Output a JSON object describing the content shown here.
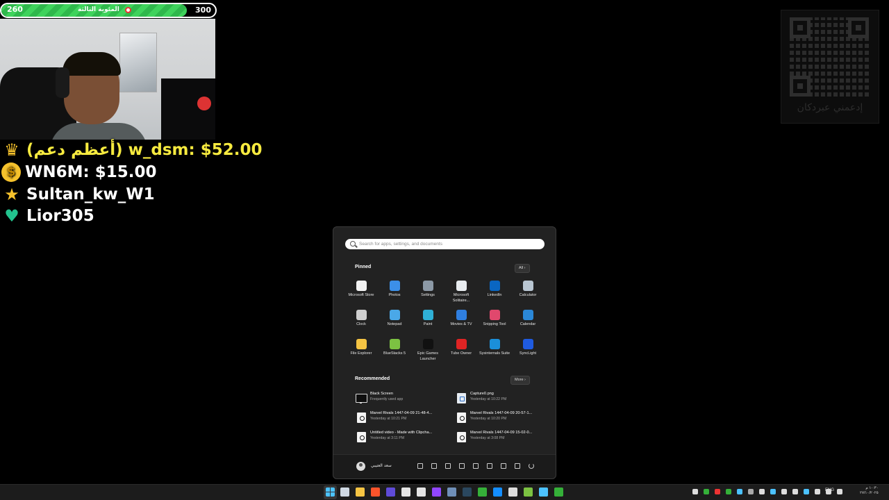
{
  "overlay": {
    "goal": {
      "current": "260",
      "target": "300",
      "title": "المئوية الثالثة",
      "progress": 0.866,
      "fill_color": "#3fd35c"
    },
    "donors": [
      {
        "badge": "crown",
        "text": "(أعظم دعم) w_dsm: $52.00"
      },
      {
        "badge": "coin",
        "text": "WN6M: $15.00"
      },
      {
        "badge": "star",
        "text": "Sultan_kw_W1"
      },
      {
        "badge": "heart",
        "text": "Lior305"
      }
    ],
    "qr_caption": "إدعمني عبردكان"
  },
  "start_menu": {
    "search_placeholder": "Search for apps, settings, and documents",
    "pinned_title": "Pinned",
    "all_label": "All",
    "pinned": [
      {
        "label": "Microsoft Store",
        "icon": "microsoft-store-icon",
        "color": "#f3f3f3"
      },
      {
        "label": "Photos",
        "icon": "photos-icon",
        "color": "#3c8fe8"
      },
      {
        "label": "Settings",
        "icon": "settings-gear-icon",
        "color": "#8c99a6"
      },
      {
        "label": "Microsoft Solitaire...",
        "icon": "solitaire-icon",
        "color": "#e8ecef"
      },
      {
        "label": "LinkedIn",
        "icon": "linkedin-icon",
        "color": "#0a66c2"
      },
      {
        "label": "Calculator",
        "icon": "calculator-icon",
        "color": "#b9c6d2"
      },
      {
        "label": "Clock",
        "icon": "clock-icon",
        "color": "#cfcfcf"
      },
      {
        "label": "Notepad",
        "icon": "notepad-icon",
        "color": "#4aa8e8"
      },
      {
        "label": "Paint",
        "icon": "paint-icon",
        "color": "#2fb0d6"
      },
      {
        "label": "Movies & TV",
        "icon": "movies-tv-icon",
        "color": "#2f7fe0"
      },
      {
        "label": "Snipping Tool",
        "icon": "snipping-tool-icon",
        "color": "#e0486d"
      },
      {
        "label": "Calendar",
        "icon": "calendar-icon",
        "color": "#2b88d8"
      },
      {
        "label": "File Explorer",
        "icon": "file-explorer-icon",
        "color": "#f5c443"
      },
      {
        "label": "BlueStacks 5",
        "icon": "bluestacks-icon",
        "color": "#7cc242"
      },
      {
        "label": "Epic Games Launcher",
        "icon": "epic-games-icon",
        "color": "#111111"
      },
      {
        "label": "Tube Owner",
        "icon": "tube-owner-icon",
        "color": "#e02424"
      },
      {
        "label": "Sysinternals Suite",
        "icon": "sysinternals-icon",
        "color": "#1b8fd9"
      },
      {
        "label": "SyncLight",
        "icon": "synclight-icon",
        "color": "#1f5be0"
      }
    ],
    "recommended_title": "Recommended",
    "more_label": "More",
    "recommended": [
      {
        "title": "Black Screen",
        "subtitle": "Frequently used app",
        "icon": "monitor"
      },
      {
        "title": "Capture0.png",
        "subtitle": "Yesterday at 10:22 PM",
        "icon": "png"
      },
      {
        "title": "Marvel Rivals  1447-04-09 21-48-4...",
        "subtitle": "Yesterday at 10:21 PM",
        "icon": "video"
      },
      {
        "title": "Marvel Rivals  1447-04-09 20-57-1...",
        "subtitle": "Yesterday at 10:20 PM",
        "icon": "video"
      },
      {
        "title": "Untitled video - Made with Clipcha...",
        "subtitle": "Yesterday at 3:11 PM",
        "icon": "video"
      },
      {
        "title": "Marvel Rivals  1447-04-09 15-02-0...",
        "subtitle": "Yesterday at 3:08 PM",
        "icon": "video"
      }
    ],
    "user_name": "سعد العتيبي"
  },
  "taskbar": {
    "apps": [
      {
        "icon": "task-view-icon",
        "color": "#cfd8e3"
      },
      {
        "icon": "file-explorer-icon",
        "color": "#f5c443"
      },
      {
        "icon": "brave-browser-icon",
        "color": "#fb542b"
      },
      {
        "icon": "streamlabs-icon",
        "color": "#5f4bd8"
      },
      {
        "icon": "chrome-icon",
        "color": "#e4e4e4"
      },
      {
        "icon": "obs-icon",
        "color": "#e4e4e4"
      },
      {
        "icon": "twitch-icon",
        "color": "#9146ff"
      },
      {
        "icon": "app-icon",
        "color": "#6f8fb8"
      },
      {
        "icon": "steam-icon",
        "color": "#2a475e"
      },
      {
        "icon": "xbox-icon",
        "color": "#35b039"
      },
      {
        "icon": "battle-net-icon",
        "color": "#148eff"
      },
      {
        "icon": "epic-games-icon",
        "color": "#dddddd"
      },
      {
        "icon": "bluestacks-icon",
        "color": "#7cc242"
      },
      {
        "icon": "apps-grid-icon",
        "color": "#4cc2ff"
      },
      {
        "icon": "globe-icon",
        "color": "#35b039"
      }
    ],
    "tray_colors": [
      "#ddd",
      "#35b039",
      "#e33",
      "#35b039",
      "#4cc2ff",
      "#aaa",
      "#ddd",
      "#4cc2ff",
      "#ddd",
      "#ddd",
      "#4cc2ff",
      "#ddd",
      "#ddd",
      "#ddd"
    ],
    "language": "ENG",
    "time": "١٠:٣٠ م",
    "date": "٢٧/١٠/٢٠٢٥"
  }
}
